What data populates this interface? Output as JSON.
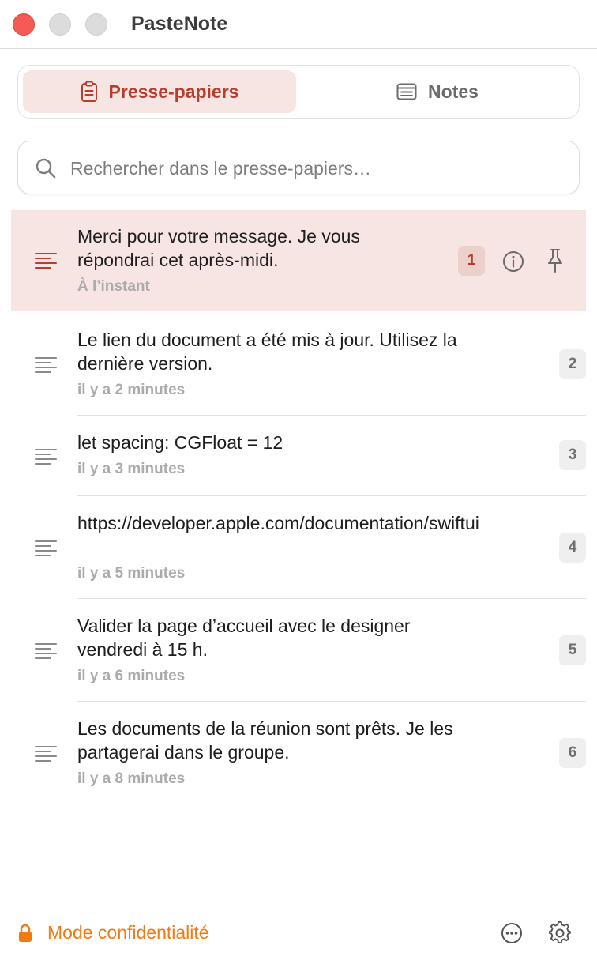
{
  "window": {
    "title": "PasteNote"
  },
  "tabs": [
    {
      "label": "Presse-papiers",
      "icon": "clipboard-icon",
      "active": true
    },
    {
      "label": "Notes",
      "icon": "note-icon",
      "active": false
    }
  ],
  "search": {
    "placeholder": "Rechercher dans le presse-papiers…",
    "value": ""
  },
  "clips": [
    {
      "text": "Merci pour votre message. Je vous répondrai cet après-midi.",
      "time": "À l’instant",
      "index": "1",
      "selected": true
    },
    {
      "text": "Le lien du document a été mis à jour. Utilisez la dernière version.",
      "time": "il y a 2 minutes",
      "index": "2",
      "selected": false
    },
    {
      "text": "let spacing: CGFloat = 12",
      "time": "il y a 3 minutes",
      "index": "3",
      "selected": false
    },
    {
      "text": "https://developer.apple.com/documentation/swiftui",
      "time": "il y a 5 minutes",
      "index": "4",
      "selected": false
    },
    {
      "text": "Valider la page d’accueil avec le designer vendredi à 15 h.",
      "time": "il y a 6 minutes",
      "index": "5",
      "selected": false
    },
    {
      "text": "Les documents de la réunion sont prêts. Je les partagerai dans le groupe.",
      "time": "il y a 8 minutes",
      "index": "6",
      "selected": false
    }
  ],
  "footer": {
    "privacy_label": "Mode confidentialité"
  },
  "colors": {
    "accent": "#b73d2c",
    "selected_bg": "#f7e5e3",
    "privacy": "#ef7b14"
  }
}
